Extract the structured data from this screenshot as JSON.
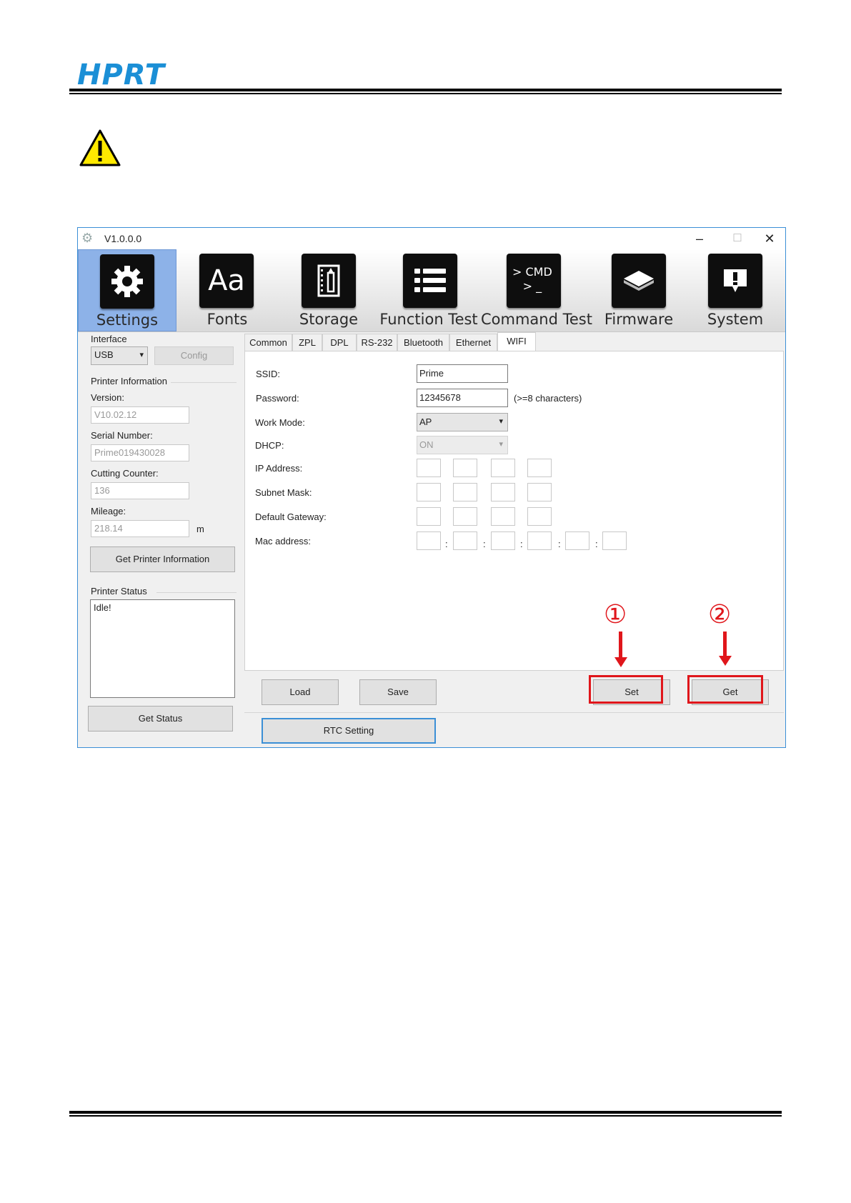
{
  "doc": {
    "logo": "HPRT"
  },
  "window": {
    "title": "V1.0.0.0",
    "minimize": "–",
    "maximize": "☐",
    "close": "✕"
  },
  "toolbar": [
    {
      "label": "Settings",
      "glyph": "⚙"
    },
    {
      "label": "Fonts",
      "glyph": "Aa"
    },
    {
      "label": "Storage",
      "glyph": "▯"
    },
    {
      "label": "Function Test",
      "glyph": "☰"
    },
    {
      "label": "Command Test",
      "glyph": "> CMD\n> _"
    },
    {
      "label": "Firmware",
      "glyph": "▦"
    },
    {
      "label": "System",
      "glyph": "!"
    }
  ],
  "left": {
    "interface_label": "Interface",
    "interface_value": "USB",
    "config_button": "Config",
    "printer_info_label": "Printer Information",
    "version_label": "Version:",
    "version_value": "V10.02.12",
    "serial_label": "Serial Number:",
    "serial_value": "Prime019430028",
    "cutting_label": "Cutting Counter:",
    "cutting_value": "136",
    "mileage_label": "Mileage:",
    "mileage_value": "218.14",
    "mileage_unit": "m",
    "get_info_button": "Get Printer Information",
    "status_label": "Printer Status",
    "status_value": "Idle!",
    "get_status_button": "Get Status"
  },
  "tabs": [
    "Common",
    "ZPL",
    "DPL",
    "RS-232",
    "Bluetooth",
    "Ethernet",
    "WIFI"
  ],
  "wifi": {
    "ssid_label": "SSID:",
    "ssid_value": "Prime",
    "password_label": "Password:",
    "password_value": "12345678",
    "password_hint": "(>=8 characters)",
    "workmode_label": "Work Mode:",
    "workmode_value": "AP",
    "dhcp_label": "DHCP:",
    "dhcp_value": "ON",
    "ip_label": "IP Address:",
    "subnet_label": "Subnet Mask:",
    "gateway_label": "Default Gateway:",
    "mac_label": "Mac address:",
    "mac_separator": ":"
  },
  "bottom": {
    "load_button": "Load",
    "save_button": "Save",
    "set_button": "Set",
    "get_button": "Get",
    "rtc_button": "RTC Setting"
  },
  "annotations": {
    "step1": "①",
    "step2": "②",
    "color": "#e0161b"
  }
}
